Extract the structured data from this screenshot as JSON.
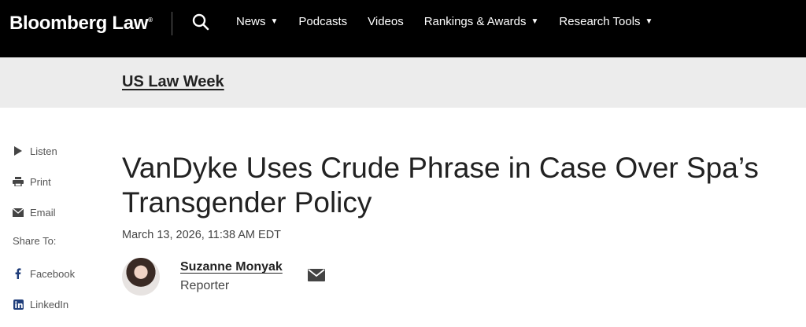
{
  "header": {
    "logo": "Bloomberg Law",
    "logo_mark": "®",
    "search_icon": "search-icon",
    "nav": [
      {
        "label": "News",
        "dropdown": true
      },
      {
        "label": "Podcasts",
        "dropdown": false
      },
      {
        "label": "Videos",
        "dropdown": false
      },
      {
        "label": "Rankings & Awards",
        "dropdown": true
      },
      {
        "label": "Research Tools",
        "dropdown": true
      }
    ]
  },
  "section": {
    "label": "US Law Week"
  },
  "sidebar": {
    "actions": [
      {
        "label": "Listen",
        "icon": "play-icon"
      },
      {
        "label": "Print",
        "icon": "printer-icon"
      },
      {
        "label": "Email",
        "icon": "mail-icon"
      }
    ],
    "share_label": "Share To:",
    "share": [
      {
        "label": "Facebook",
        "icon": "facebook-icon"
      },
      {
        "label": "LinkedIn",
        "icon": "linkedin-icon"
      }
    ]
  },
  "article": {
    "headline": "VanDyke Uses Crude Phrase in Case Over Spa’s Transgender Policy",
    "dateline": "March 13, 2026, 11:38 AM EDT",
    "author": {
      "name": "Suzanne Monyak",
      "role": "Reporter"
    }
  },
  "colors": {
    "header_bg": "#000000",
    "subbar_bg": "#ececec",
    "text": "#222222"
  }
}
